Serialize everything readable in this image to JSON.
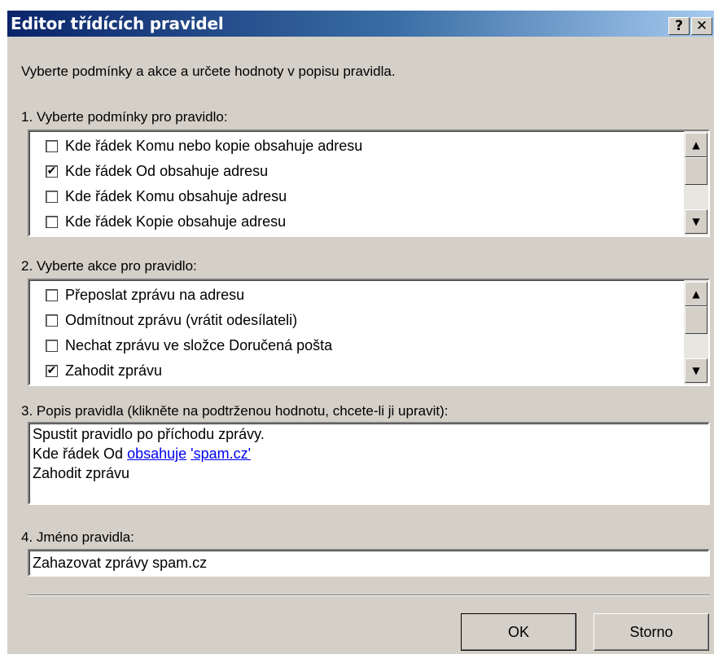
{
  "window": {
    "title": "Editor třídících pravidel",
    "help_label": "?",
    "close_label": "✕"
  },
  "intro": "Vyberte podmínky a akce a určete hodnoty v popisu pravidla.",
  "conditions": {
    "label": "1. Vyberte podmínky pro pravidlo:",
    "items": [
      {
        "label": "Kde řádek Komu nebo kopie obsahuje adresu",
        "checked": false,
        "mark": ""
      },
      {
        "label": "Kde řádek Od obsahuje adresu",
        "checked": true,
        "mark": "✔"
      },
      {
        "label": "Kde řádek Komu obsahuje adresu",
        "checked": false,
        "mark": ""
      },
      {
        "label": "Kde řádek Kopie obsahuje adresu",
        "checked": false,
        "mark": ""
      }
    ]
  },
  "actions": {
    "label": "2. Vyberte akce pro pravidlo:",
    "items": [
      {
        "label": "Přeposlat zprávu na adresu",
        "checked": false,
        "mark": ""
      },
      {
        "label": "Odmítnout zprávu (vrátit odesílateli)",
        "checked": false,
        "mark": ""
      },
      {
        "label": "Nechat zprávu ve složce Doručená pošta",
        "checked": false,
        "mark": ""
      },
      {
        "label": "Zahodit zprávu",
        "checked": true,
        "mark": "✔"
      }
    ]
  },
  "description": {
    "label": "3. Popis pravidla (klikněte na podtrženou hodnotu, chcete-li ji upravit):",
    "line1": "Spustit pravidlo po příchodu zprávy.",
    "line2_prefix": "Kde řádek Od ",
    "line2_link1": "obsahuje",
    "line2_link2": "'spam.cz'",
    "line3": "Zahodit zprávu"
  },
  "rule_name": {
    "label": "4. Jméno pravidla:",
    "value": "Zahazovat zprávy spam.cz"
  },
  "buttons": {
    "ok": "OK",
    "cancel": "Storno"
  },
  "scroll": {
    "up_icon": "▲",
    "down_icon": "▼"
  }
}
